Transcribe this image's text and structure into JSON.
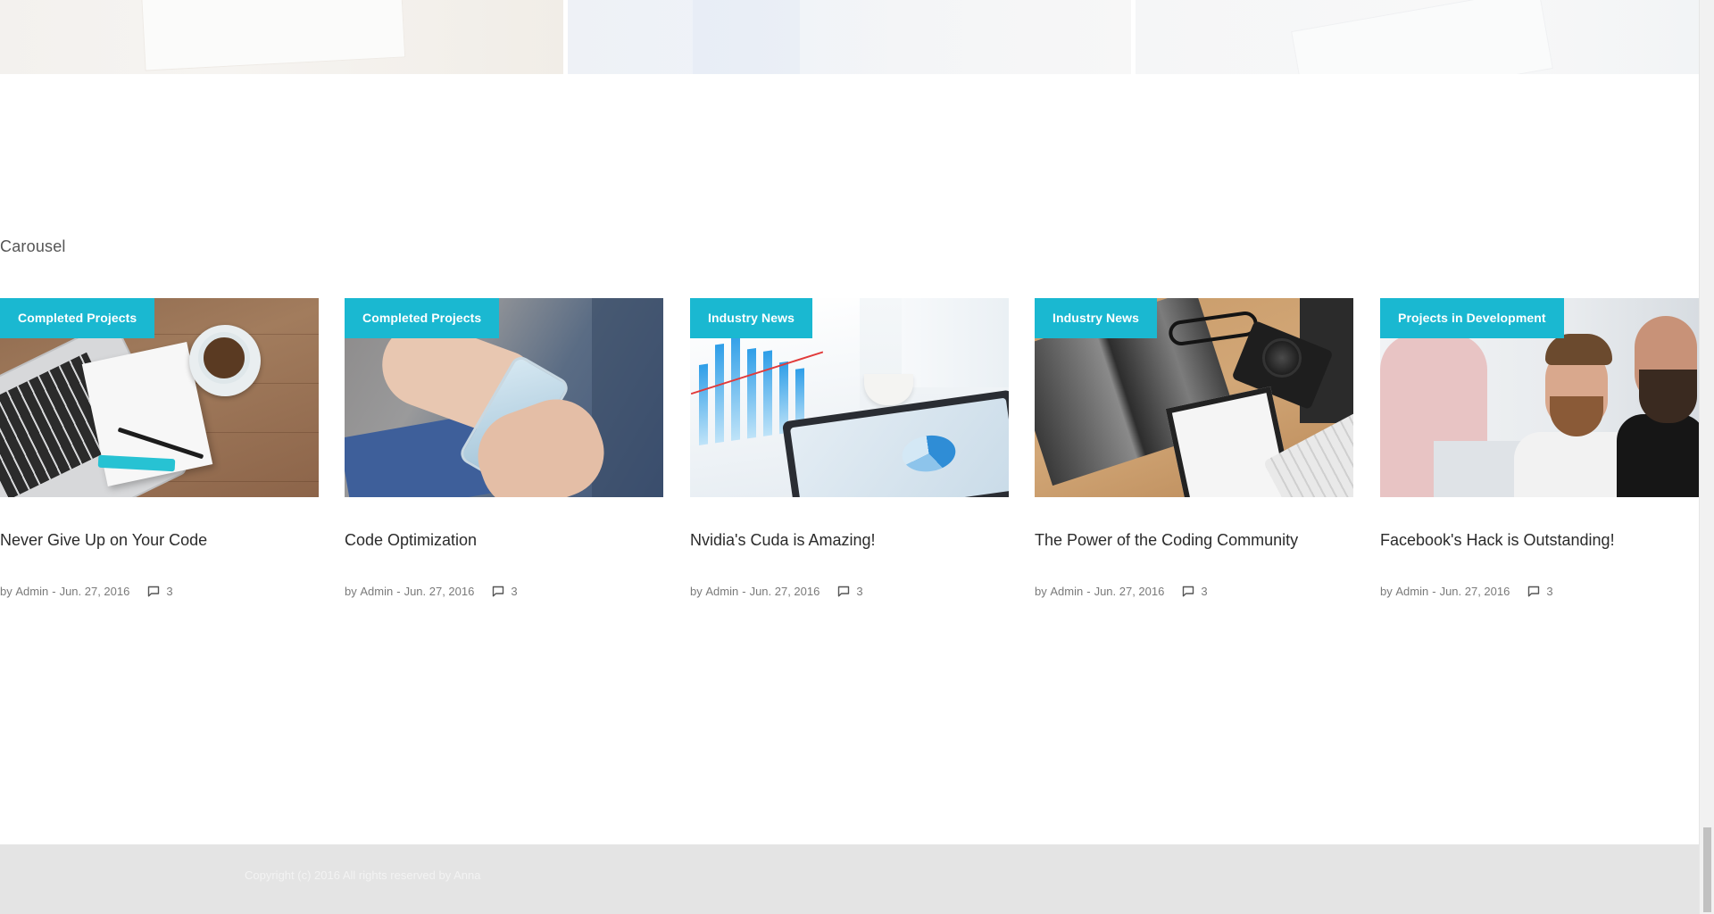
{
  "section": {
    "title": "Carousel"
  },
  "posts": [
    {
      "category": "Completed Projects",
      "title": "Never Give Up on Your Code",
      "meta_prefix": "by",
      "author": "Admin",
      "separator": "-",
      "date": "Jun. 27, 2016",
      "comments": "3",
      "image": "laptop-notepad-coffee-on-wood"
    },
    {
      "category": "Completed Projects",
      "title": "Code Optimization",
      "meta_prefix": "by",
      "author": "Admin",
      "separator": "-",
      "date": "Jun. 27, 2016",
      "comments": "3",
      "image": "hands-holding-smartphone"
    },
    {
      "category": "Industry News",
      "title": "Nvidia's Cuda is Amazing!",
      "meta_prefix": "by",
      "author": "Admin",
      "separator": "-",
      "date": "Jun. 27, 2016",
      "comments": "3",
      "image": "charts-and-tablet"
    },
    {
      "category": "Industry News",
      "title": "The Power of the Coding Community",
      "meta_prefix": "by",
      "author": "Admin",
      "separator": "-",
      "date": "Jun. 27, 2016",
      "comments": "3",
      "image": "desk-flatlay-camera-notebook"
    },
    {
      "category": "Projects in Development",
      "title": "Facebook's Hack is Outstanding!",
      "meta_prefix": "by",
      "author": "Admin",
      "separator": "-",
      "date": "Jun. 27, 2016",
      "comments": "3",
      "image": "bearded-men-at-laptop"
    }
  ],
  "footer": {
    "copyright": "Copyright (c) 2016 All rights reserved by Anna"
  },
  "colors": {
    "accent": "#1ab8d1",
    "footer_bg": "#e4e4e4",
    "text": "#2b2b2b",
    "meta": "#7a7a7a"
  },
  "icons": {
    "comment": "comment-icon"
  }
}
